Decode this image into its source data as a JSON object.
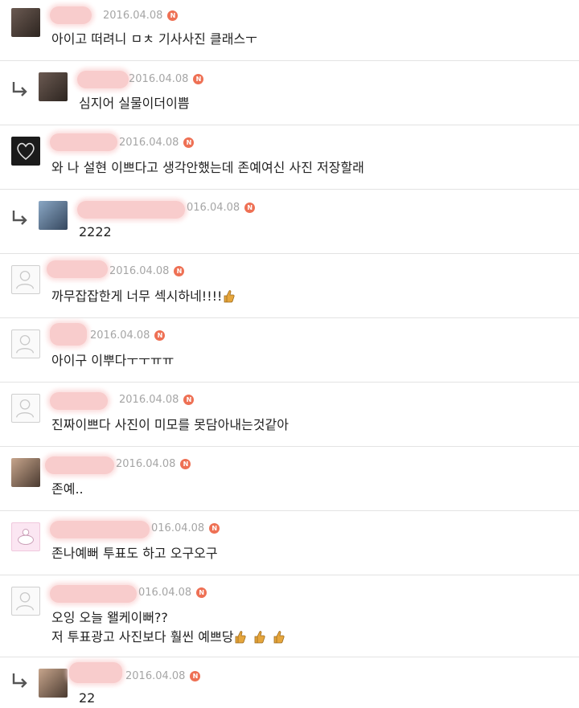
{
  "comments": [
    {
      "date": "2016.04.08",
      "badge": "N",
      "text": "아이고 떠려니 ㅁㅊ 기사사진 클래스ㅜ",
      "reply": false,
      "avatar": "photo"
    },
    {
      "date": "2016.04.08",
      "badge": "N",
      "text": "심지어 실물이더이쁨",
      "reply": true,
      "avatar": "photo"
    },
    {
      "date": "2016.04.08",
      "badge": "N",
      "text": "와 나 설현 이쁘다고 생각안했는데 존예여신 사진 저장할래",
      "reply": false,
      "avatar": "logo"
    },
    {
      "date": "016.04.08",
      "badge": "N",
      "text": "2222",
      "reply": true,
      "avatar": "photo2"
    },
    {
      "date": "2016.04.08",
      "badge": "N",
      "text": "까무잡잡한게 너무 섹시하네!!!!",
      "reply": false,
      "avatar": "placeholder",
      "thumbs": 1
    },
    {
      "date": "2016.04.08",
      "badge": "N",
      "text": "아이구 이뿌다ㅜㅜㅠㅠ",
      "reply": false,
      "avatar": "placeholder"
    },
    {
      "date": "2016.04.08",
      "badge": "N",
      "text": "진짜이쁘다 사진이 미모를 못담아내는것같아",
      "reply": false,
      "avatar": "placeholder"
    },
    {
      "date": "2016.04.08",
      "badge": "N",
      "text": "존예..",
      "reply": false,
      "avatar": "photo3"
    },
    {
      "date": "016.04.08",
      "badge": "N",
      "text": "존나예뻐 투표도 하고 오구오구",
      "reply": false,
      "avatar": "cartoon"
    },
    {
      "date": "016.04.08",
      "badge": "N",
      "text": "오잉 오늘 왤케이뻐??",
      "text2": "저 투표광고 사진보다 훨씬 예쁘당",
      "reply": false,
      "avatar": "placeholder",
      "thumbs2": 3
    },
    {
      "date": "2016.04.08",
      "badge": "N",
      "text": "22",
      "reply": true,
      "avatar": "photo3"
    }
  ]
}
